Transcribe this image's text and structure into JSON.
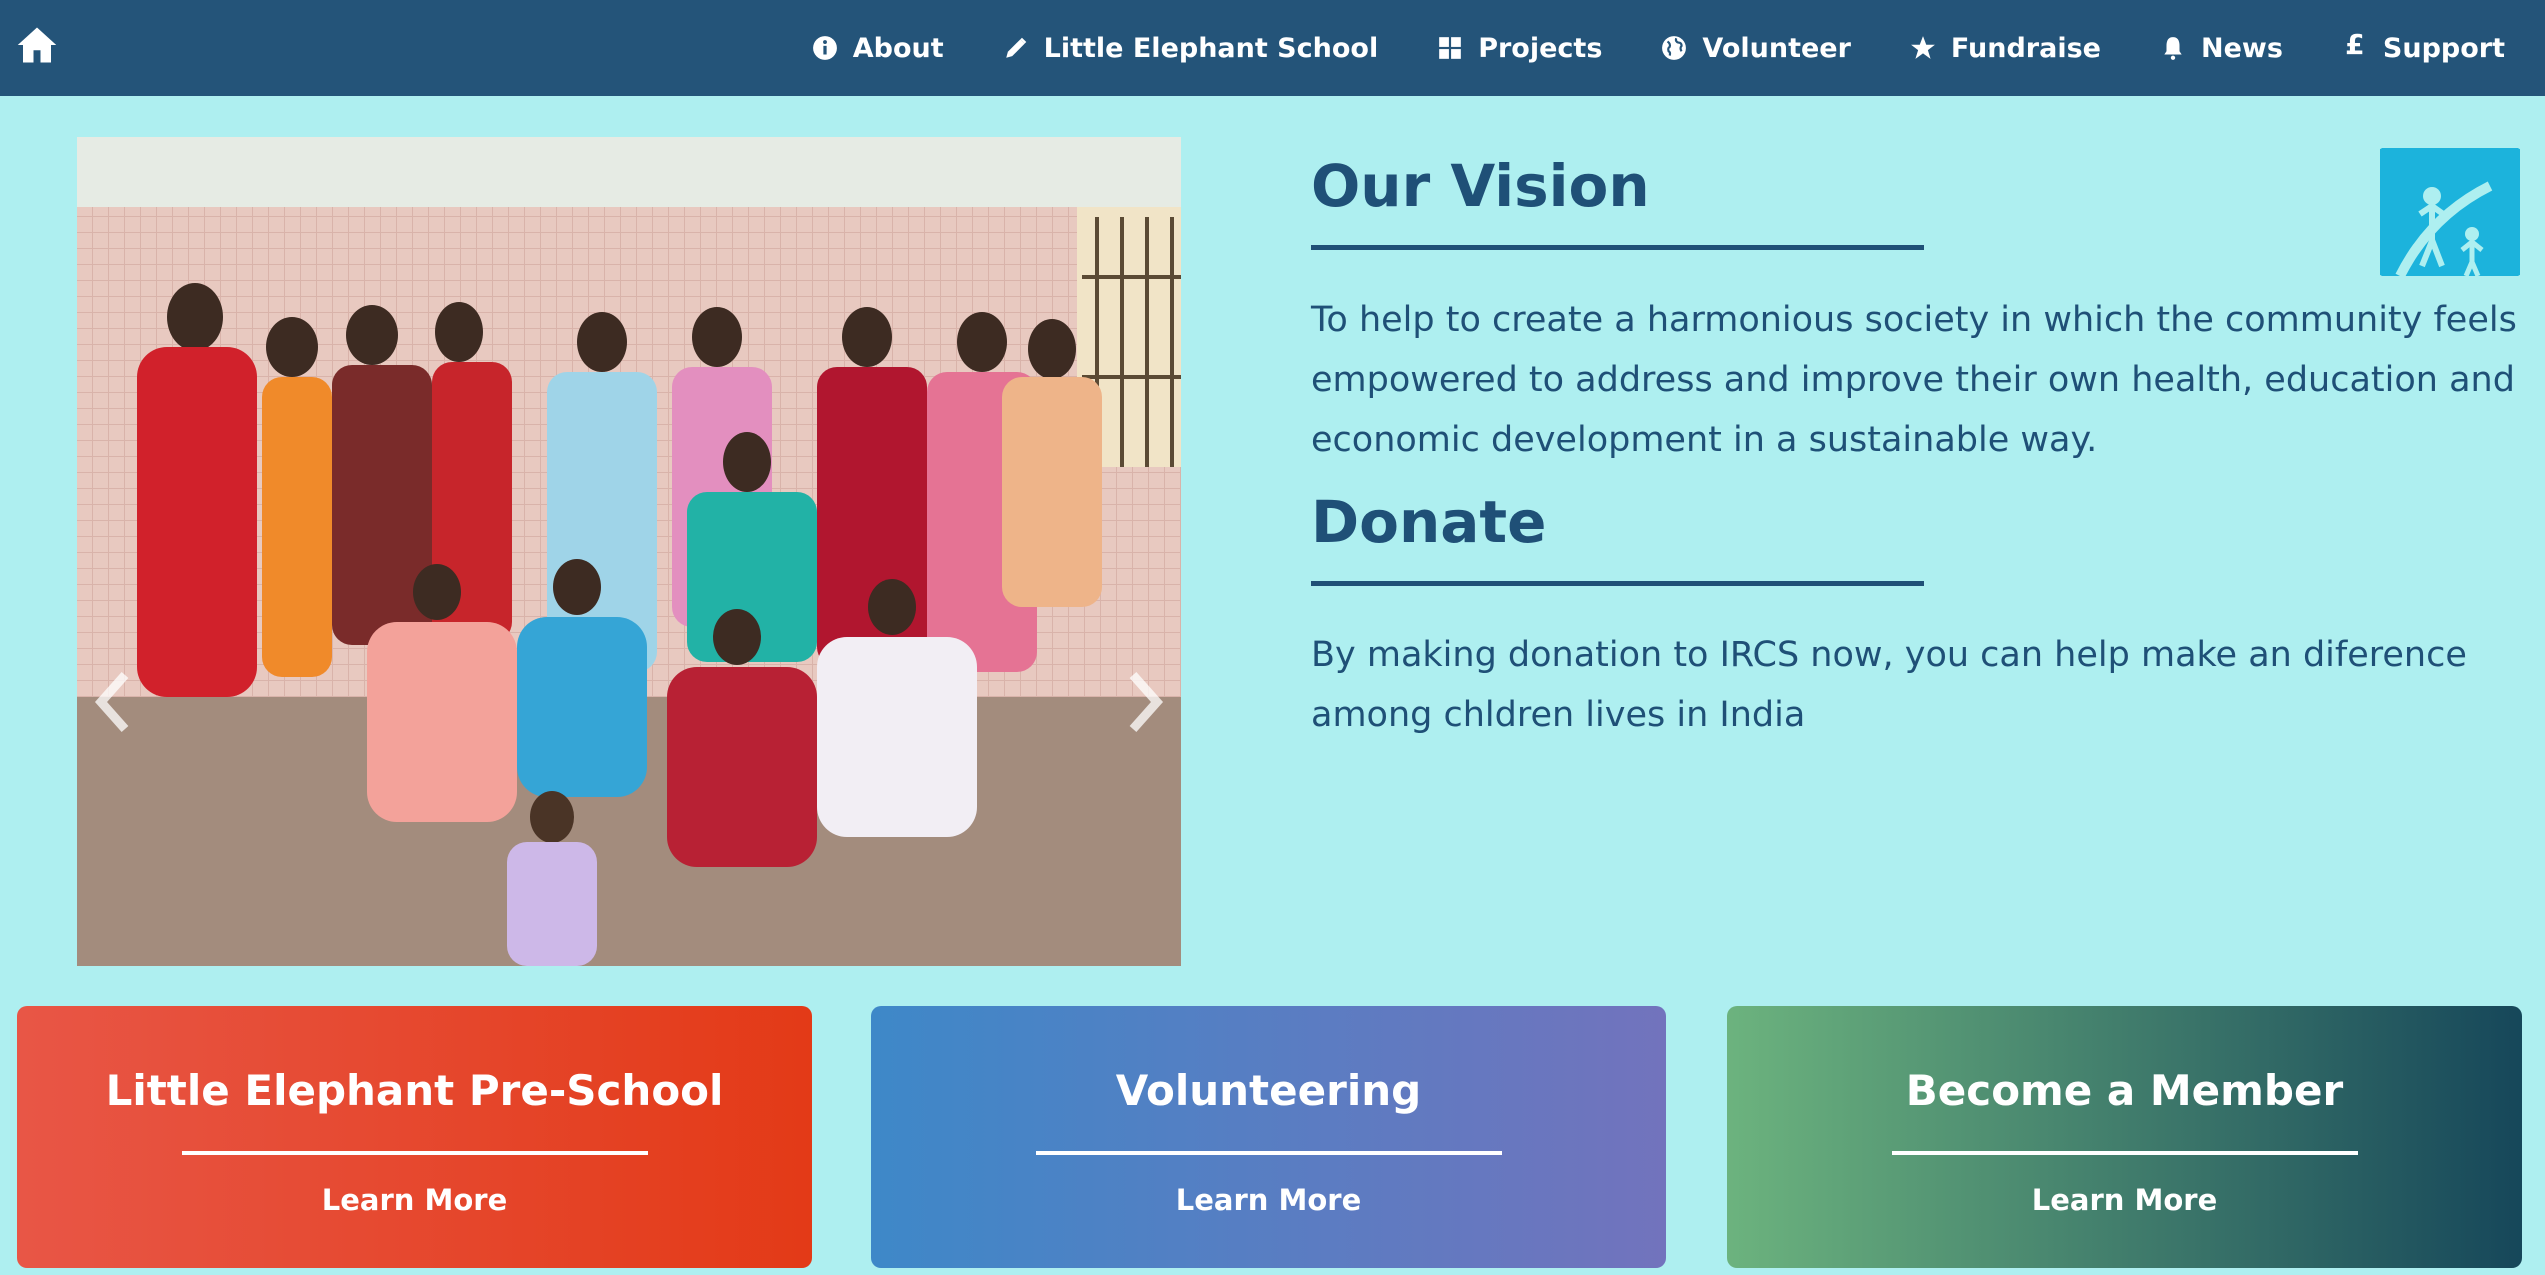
{
  "nav": {
    "home_icon": "home-icon",
    "items": [
      {
        "label": "About",
        "icon": "info-icon"
      },
      {
        "label": "Little Elephant School",
        "icon": "pencil-icon"
      },
      {
        "label": "Projects",
        "icon": "grid-icon"
      },
      {
        "label": "Volunteer",
        "icon": "globe-icon"
      },
      {
        "label": "Fundraise",
        "icon": "star-icon"
      },
      {
        "label": "News",
        "icon": "bell-icon"
      },
      {
        "label": "Support",
        "icon": "pound-icon",
        "glyph": "£"
      }
    ]
  },
  "carousel": {
    "slide_count": 4,
    "active_slide": 4,
    "prev_icon": "chevron-left-icon",
    "next_icon": "chevron-right-icon"
  },
  "vision": {
    "heading": "Our Vision",
    "text": "To help to create a harmonious society in which the community feels empowered to address and improve their own health, education and economic development in a sustainable way."
  },
  "donate": {
    "heading": "Donate",
    "text": "By making donation to IRCS now, you can help make an diference among chldren lives in India"
  },
  "cards": [
    {
      "title": "Little Elephant Pre-School",
      "link": "Learn More",
      "colors": [
        "#e85646",
        "#e33a17"
      ]
    },
    {
      "title": "Volunteering",
      "link": "Learn More",
      "colors": [
        "#3e88c8",
        "#7273bd"
      ]
    },
    {
      "title": "Become a Member",
      "link": "Learn More",
      "colors": [
        "#6cb37e",
        "#16475a"
      ]
    }
  ],
  "colors": {
    "nav_bg": "#245479",
    "page_bg": "#aeeff0",
    "heading": "#1f5077",
    "logo": "#1cb3dc"
  }
}
